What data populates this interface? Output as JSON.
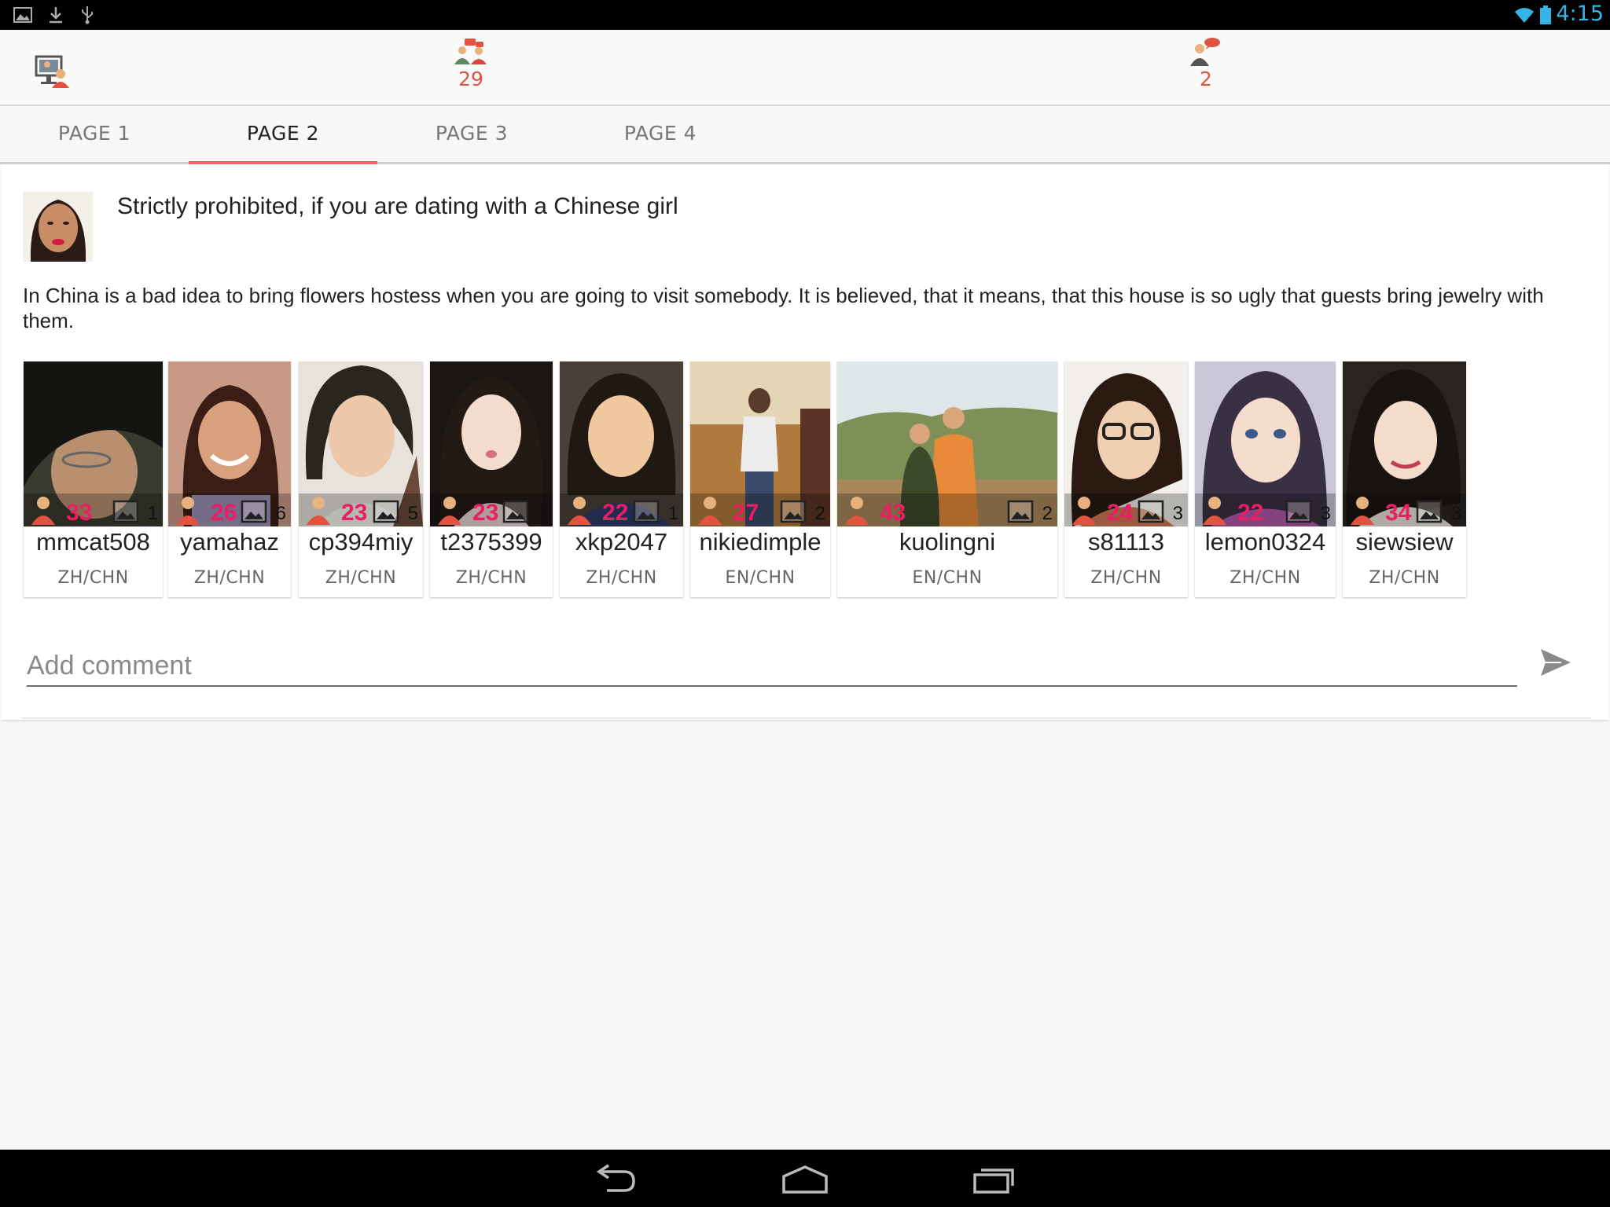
{
  "status_bar": {
    "time": "4:15",
    "left_icons": [
      "image-icon",
      "download-icon",
      "usb-icon"
    ],
    "right_icons": [
      "wifi-icon",
      "battery-icon"
    ]
  },
  "header": {
    "icons": [
      "broadcast-users-icon",
      "chat-group-icon",
      "message-user-icon"
    ],
    "group_chat_count": "29",
    "messages_count": "2",
    "count_color": "#e0533e"
  },
  "tabs": [
    {
      "label": "PAGE 1",
      "active": false
    },
    {
      "label": "PAGE 2",
      "active": true
    },
    {
      "label": "PAGE 3",
      "active": false
    },
    {
      "label": "PAGE 4",
      "active": false
    }
  ],
  "post": {
    "title": "Strictly prohibited, if you are dating with a Chinese girl",
    "body": "In China is a bad idea to bring flowers hostess when you are going to visit somebody. It is believed, that it means, that this house is so ugly that guests bring jewelry with them."
  },
  "users": [
    {
      "name": "mmcat508",
      "age": "33",
      "photos": "1",
      "lang": "ZH/CHN"
    },
    {
      "name": "yamahaz",
      "age": "26",
      "photos": "6",
      "lang": "ZH/CHN"
    },
    {
      "name": "cp394miy",
      "age": "23",
      "photos": "5",
      "lang": "ZH/CHN"
    },
    {
      "name": "t2375399",
      "age": "23",
      "photos": "1",
      "lang": "ZH/CHN"
    },
    {
      "name": "xkp2047",
      "age": "22",
      "photos": "1",
      "lang": "ZH/CHN"
    },
    {
      "name": "nikiedimple",
      "age": "27",
      "photos": "2",
      "lang": "EN/CHN"
    },
    {
      "name": "kuolingni",
      "age": "43",
      "photos": "2",
      "lang": "EN/CHN"
    },
    {
      "name": "s81113",
      "age": "24",
      "photos": "3",
      "lang": "ZH/CHN"
    },
    {
      "name": "lemon0324",
      "age": "22",
      "photos": "3",
      "lang": "ZH/CHN"
    },
    {
      "name": "siewsiew",
      "age": "34",
      "photos": "3",
      "lang": "ZH/CHN"
    }
  ],
  "comment": {
    "placeholder": "Add comment",
    "send_icon": "send-icon"
  },
  "nav_bar": {
    "icons": [
      "back-icon",
      "home-icon",
      "recents-icon"
    ]
  },
  "colors": {
    "accent": "#e56b64",
    "age": "#e91e63",
    "status_time": "#35b5e5"
  }
}
